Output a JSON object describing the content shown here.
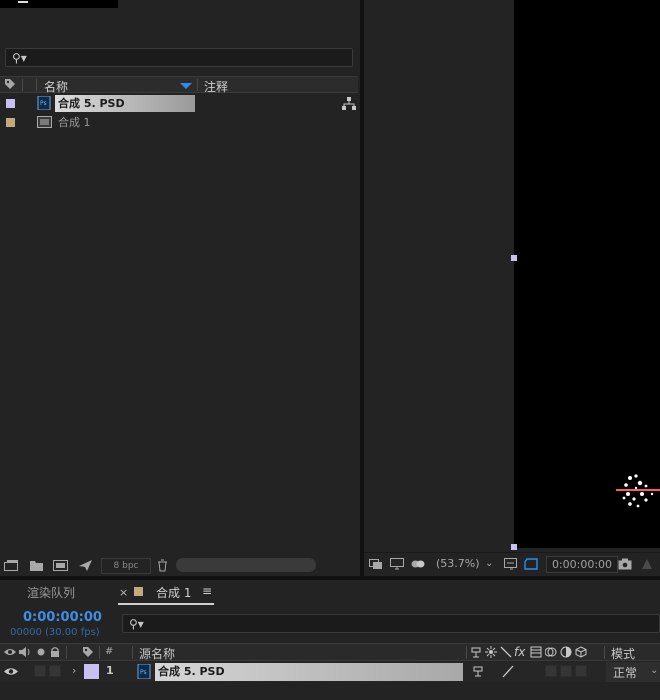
{
  "project": {
    "search_glyph": "⚲▾",
    "columns": {
      "name": "名称",
      "comment": "注释"
    },
    "items": [
      {
        "name": "合成 5. PSD",
        "swatch": "#c8c0f0",
        "icon": "psd-file-icon",
        "selected": true
      },
      {
        "name": "合成 1",
        "swatch": "#c4a97a",
        "icon": "composition-icon",
        "selected": false
      }
    ],
    "footer": {
      "bpc": "8 bpc"
    }
  },
  "viewer": {
    "zoom": "(53.7%)",
    "timecode": "0:00:00:00"
  },
  "timeline": {
    "tabs": {
      "render_queue": "渲染队列",
      "close": "×",
      "comp": "合成 1",
      "menu": "≡"
    },
    "current_time": "0:00:00:00",
    "time_sub": "00000 (30.00 fps)",
    "search_glyph": "⚲▾",
    "columns": {
      "hash": "#",
      "source_name": "源名称",
      "mode": "模式"
    },
    "layers": [
      {
        "index": "1",
        "name": "合成 5. PSD",
        "label_color": "#c8c0f0",
        "mode": "正常"
      }
    ]
  },
  "colors": {
    "accent_blue": "#2d8ceb",
    "panel_bg": "#232323",
    "canvas": "#000000"
  }
}
